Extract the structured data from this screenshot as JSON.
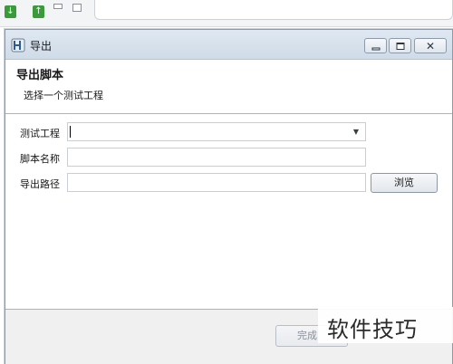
{
  "toolbar": {
    "icons": [
      "green-download-icon",
      "green-upload-icon",
      "minimize-icon",
      "maximize-icon"
    ]
  },
  "dialog": {
    "title": "导出",
    "window_buttons": [
      "minimize",
      "maximize",
      "close"
    ],
    "close_glyph": "✕",
    "header": {
      "title": "导出脚本",
      "description": "选择一个测试工程"
    },
    "form": {
      "project_label": "测试工程",
      "project_value": "",
      "script_name_label": "脚本名称",
      "script_name_value": "",
      "export_path_label": "导出路径",
      "export_path_value": "",
      "dropdown_glyph": "▼",
      "browse_label": "浏览"
    },
    "footer": {
      "finish_label": "完成"
    }
  },
  "watermark": {
    "text": "软件技巧"
  },
  "colors": {
    "titlebar": "#d6e1ec",
    "toolbar_icon": "#3b9a3a",
    "border": "#8e9aa8"
  }
}
